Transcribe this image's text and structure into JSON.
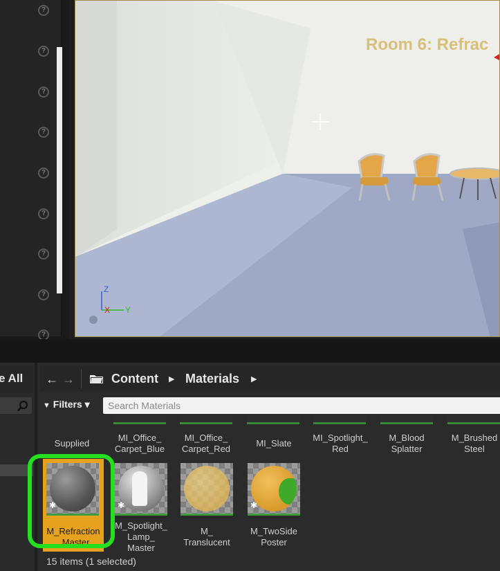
{
  "viewport": {
    "room_title": "Room 6: Refrac",
    "axis_z": "Z",
    "axis_x": "X",
    "axis_y": "Y"
  },
  "sidebar": {
    "see_all_label": "e All"
  },
  "content_browser": {
    "nav": {
      "back": "←",
      "forward": "→"
    },
    "breadcrumb": [
      "Content",
      "Materials"
    ],
    "filters_label": "Filters ▾",
    "search_placeholder": "Search Materials",
    "row1_labels": [
      "Supplied",
      "MI_Office_\nCarpet_Blue",
      "MI_Office_\nCarpet_Red",
      "MI_Slate",
      "MI_Spotlight_\nRed",
      "M_Blood\nSplatter",
      "M_Brushed\nSteel"
    ],
    "assets": [
      {
        "label": "M_Refraction\n_Master",
        "selected": true
      },
      {
        "label": "M_Spotlight_\nLamp_\nMaster",
        "selected": false
      },
      {
        "label": "M_\nTranslucent",
        "selected": false
      },
      {
        "label": "M_TwoSide\nPoster",
        "selected": false
      }
    ],
    "status": "15 items (1 selected)"
  },
  "colors": {
    "selection": "#e7a21d",
    "highlight_ring": "#24e01e",
    "asset_underline": "#3e9a3e"
  }
}
